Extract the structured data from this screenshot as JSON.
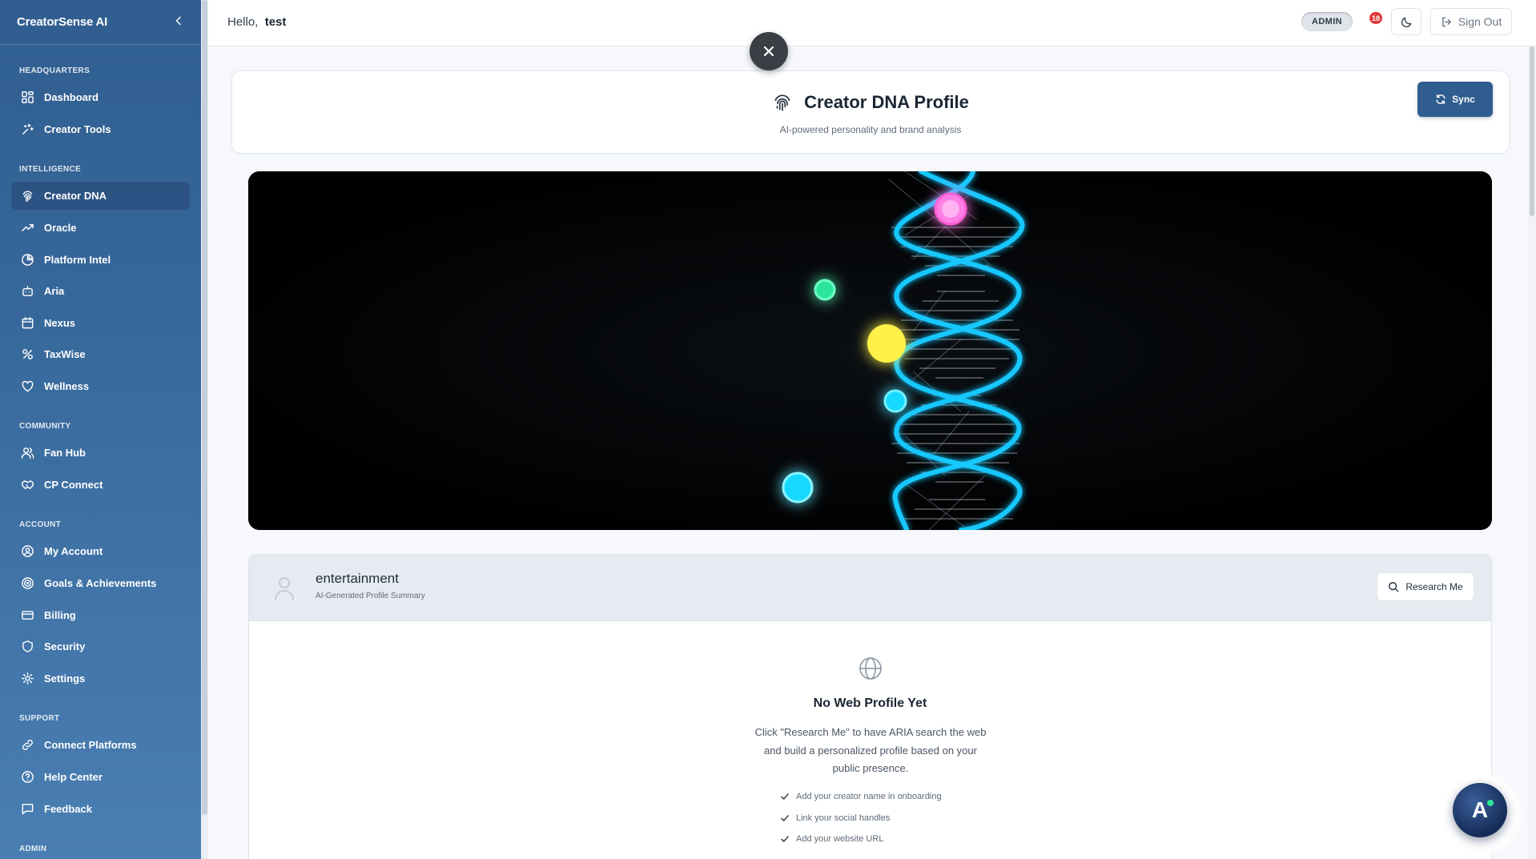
{
  "sidebar": {
    "brand": "CreatorSense AI",
    "sections": {
      "headquarters": "HEADQUARTERS",
      "intelligence": "INTELLIGENCE",
      "community": "COMMUNITY",
      "account": "ACCOUNT",
      "support": "SUPPORT",
      "admin": "ADMIN"
    },
    "items": {
      "dashboard": "Dashboard",
      "creator_tools": "Creator Tools",
      "creator_dna": "Creator DNA",
      "oracle": "Oracle",
      "platform_intel": "Platform Intel",
      "aria": "Aria",
      "nexus": "Nexus",
      "taxwise": "TaxWise",
      "wellness": "Wellness",
      "fan_hub": "Fan Hub",
      "cp_connect": "CP Connect",
      "my_account": "My Account",
      "goals": "Goals & Achievements",
      "billing": "Billing",
      "security": "Security",
      "settings": "Settings",
      "connect_platforms": "Connect Platforms",
      "help_center": "Help Center",
      "feedback": "Feedback"
    },
    "active_item": "Creator DNA"
  },
  "topbar": {
    "greeting": "Hello,",
    "username": "test",
    "role_badge": "ADMIN",
    "notification_count": "18",
    "sign_out_label": "Sign Out"
  },
  "header": {
    "title": "Creator DNA Profile",
    "subtitle": "AI-powered personality and brand analysis",
    "sync_label": "Sync"
  },
  "profile": {
    "name": "entertainment",
    "meta": "AI-Generated Profile Summary",
    "research_label": "Research Me",
    "empty_title": "No Web Profile Yet",
    "empty_desc": "Click \"Research Me\" to have ARIA search the web and build a personalized profile based on your public presence.",
    "checklist": [
      "Add your creator name in onboarding",
      "Link your social handles",
      "Add your website URL"
    ]
  },
  "assistant": {
    "fab_letter": "A"
  },
  "colors": {
    "sidebar_top": "#2f5d8f",
    "sidebar_bottom": "#4a7fb3",
    "primary": "#2f5d8f",
    "helix": "#18c8ff",
    "badge": "#e03a3a"
  }
}
